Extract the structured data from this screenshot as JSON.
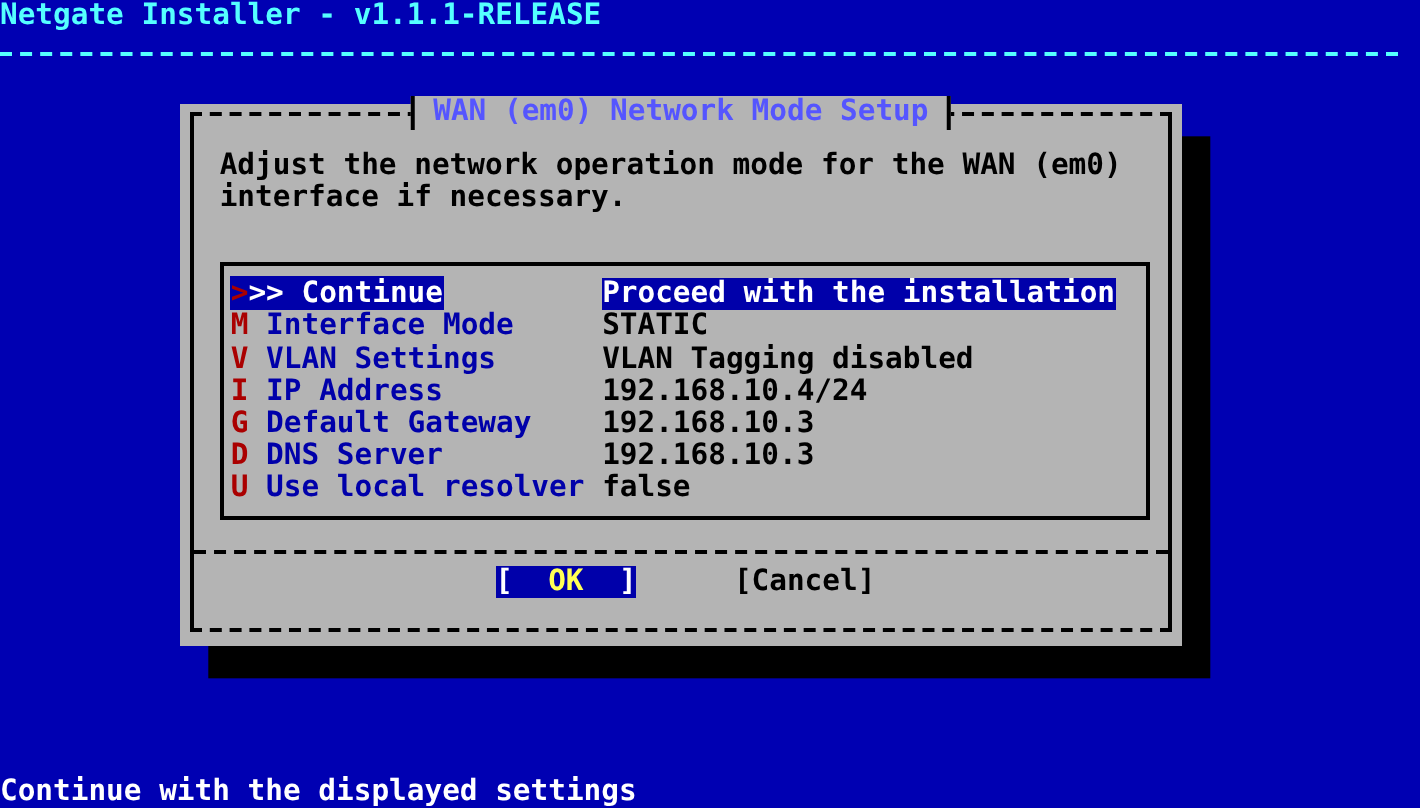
{
  "header": {
    "title": "Netgate Installer - v1.1.1-RELEASE"
  },
  "dialog": {
    "title": "WAN (em0) Network Mode Setup",
    "message": "Adjust the network operation mode for the WAN (em0) interface if necessary.",
    "menu": [
      {
        "kind": "action",
        "hotkey": ">",
        "label": ">> Continue",
        "value": "Proceed with the installation",
        "selected": true
      },
      {
        "kind": "option",
        "hotkey": "M",
        "label": "Interface Mode",
        "value": "STATIC",
        "selected": false
      },
      {
        "kind": "option",
        "hotkey": "V",
        "label": "VLAN Settings",
        "value": "VLAN Tagging disabled",
        "selected": false
      },
      {
        "kind": "option",
        "hotkey": "I",
        "label": "IP Address",
        "value": "192.168.10.4/24",
        "selected": false
      },
      {
        "kind": "option",
        "hotkey": "G",
        "label": "Default Gateway",
        "value": "192.168.10.3",
        "selected": false
      },
      {
        "kind": "option",
        "hotkey": "D",
        "label": "DNS Server",
        "value": "192.168.10.3",
        "selected": false
      },
      {
        "kind": "option",
        "hotkey": "U",
        "label": "Use local resolver",
        "value": "false",
        "selected": false
      }
    ],
    "buttons": [
      {
        "open": "[",
        "label": "OK",
        "close": "]",
        "selected": true
      },
      {
        "open": "[",
        "label": "Cancel",
        "close": "]",
        "selected": false
      }
    ]
  },
  "status_bar": "Continue with the displayed settings"
}
